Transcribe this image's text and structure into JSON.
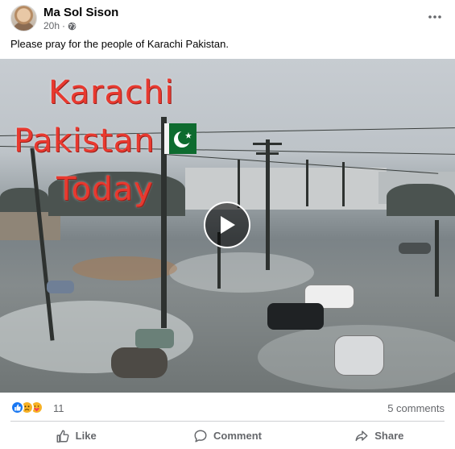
{
  "post": {
    "author": "Ma Sol Sison",
    "time": "20h",
    "audience_icon": "globe-icon",
    "more_icon": "more-horizontal-icon",
    "text": "Please pray for the people of Karachi Pakistan."
  },
  "video": {
    "overlay_lines": [
      "Karachi",
      "Pakistan",
      "Today"
    ],
    "play_icon": "play-icon",
    "flag": "pakistan-flag"
  },
  "stats": {
    "reaction_icons": [
      "like-icon",
      "sad-icon",
      "care-icon"
    ],
    "reaction_count": "11",
    "comments": "5 comments"
  },
  "actions": {
    "like": "Like",
    "comment": "Comment",
    "share": "Share"
  },
  "colors": {
    "overlay_text": "#e8392f",
    "meta_text": "#65676b",
    "like_blue": "#1877f2",
    "flag_green": "#0e6b2f"
  }
}
